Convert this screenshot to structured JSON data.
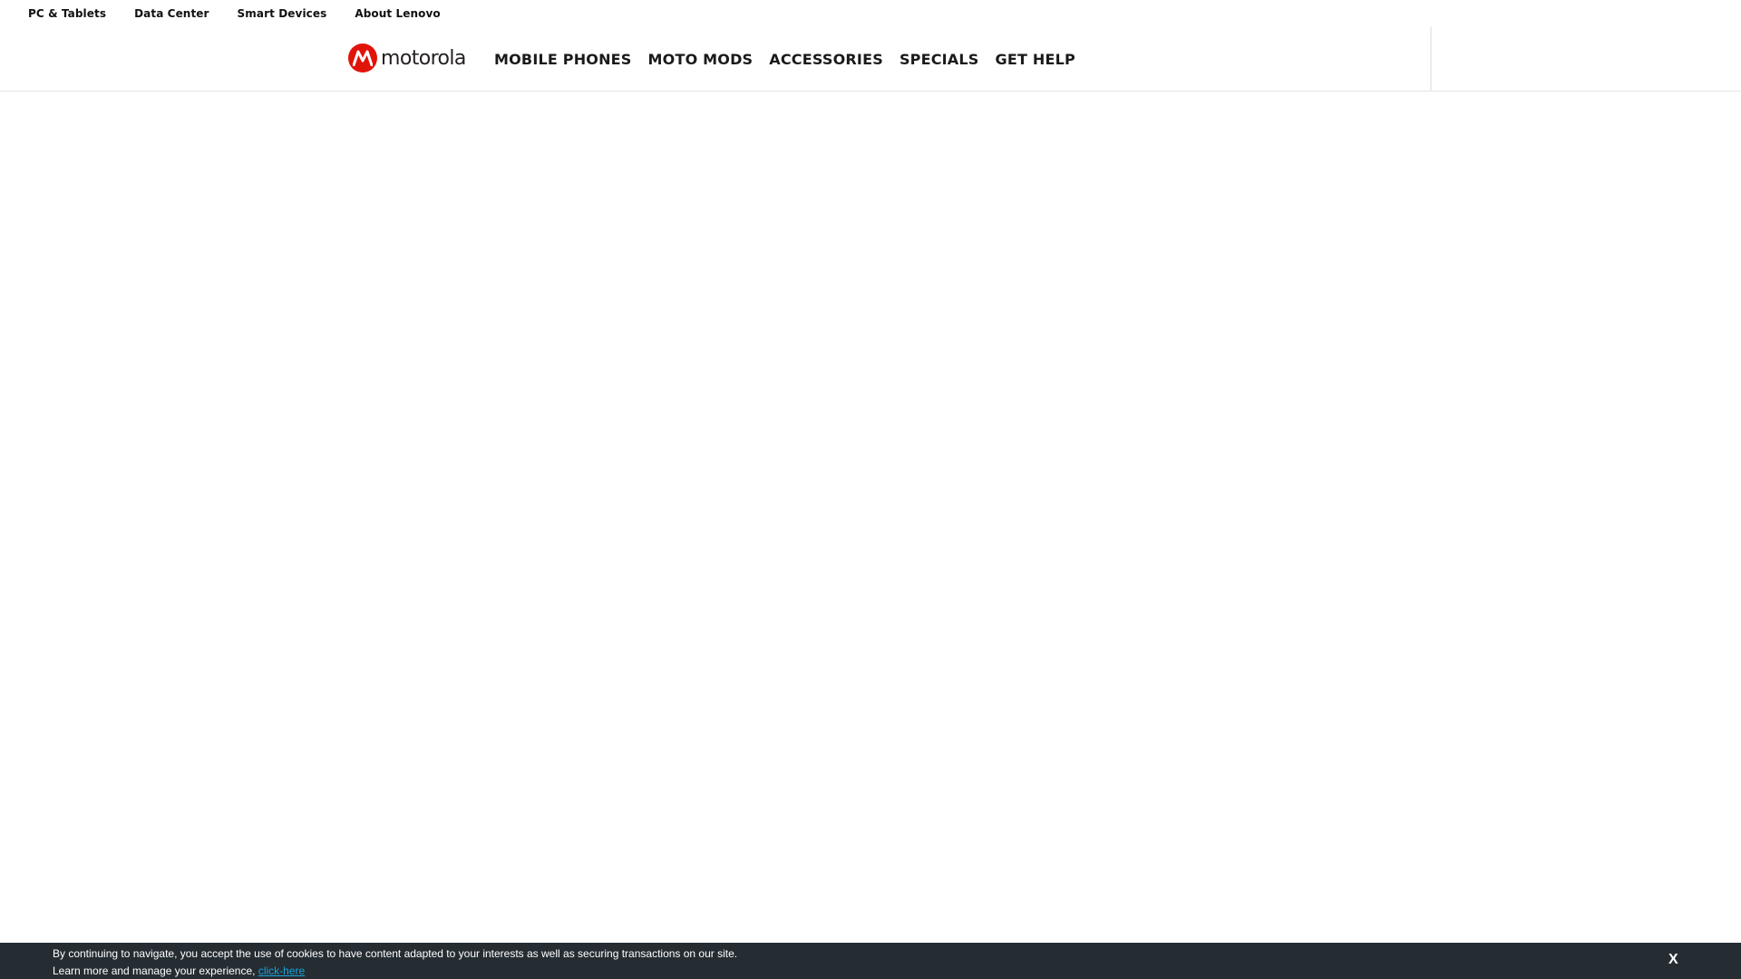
{
  "utility_nav": {
    "items": [
      {
        "label": "PC & Tablets"
      },
      {
        "label": "Data Center"
      },
      {
        "label": "Smart Devices"
      },
      {
        "label": "About Lenovo"
      }
    ]
  },
  "header": {
    "logo_text": "motorola",
    "logo_icon": "motorola-batwing-icon",
    "nav": [
      {
        "label": "MOBILE PHONES"
      },
      {
        "label": "MOTO MODS"
      },
      {
        "label": "ACCESSORIES"
      },
      {
        "label": "SPECIALS"
      },
      {
        "label": "GET HELP"
      }
    ]
  },
  "cookie_notice": {
    "line1": "By continuing to navigate, you accept the use of cookies to have content adapted to your interests as well as securing transactions on our site.",
    "line2": "Learn more and manage your experience,",
    "link_label": "click-here",
    "close_label": "X"
  },
  "colors": {
    "brand_red": "#e1140a",
    "cookie_bar_bg": "#252d33",
    "link": "#1aa3d9"
  }
}
